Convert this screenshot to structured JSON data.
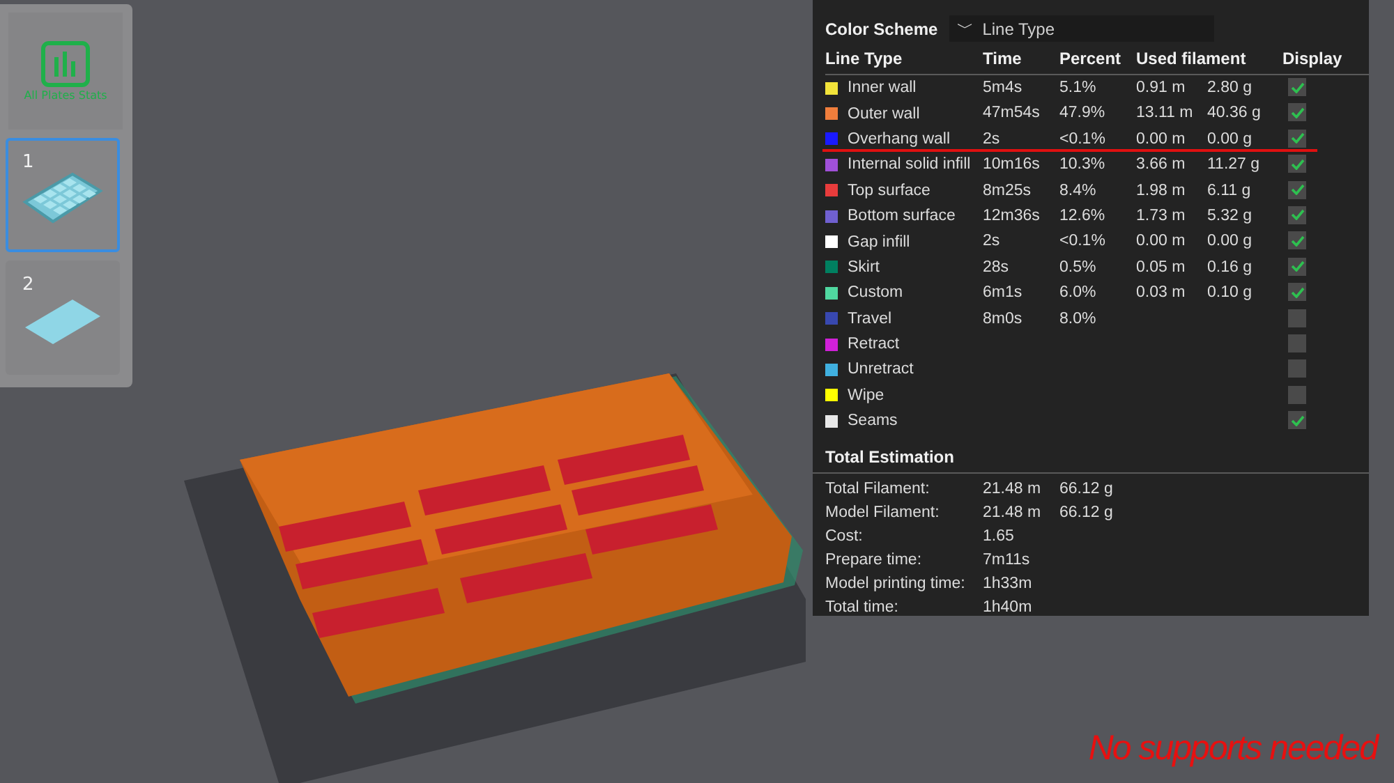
{
  "plates_sidebar": {
    "stats_button": {
      "label": "All Plates Stats"
    },
    "plates": [
      {
        "number": "1",
        "selected": true,
        "kind": "grid"
      },
      {
        "number": "2",
        "selected": false,
        "kind": "flat"
      }
    ]
  },
  "slicing_result": {
    "color_scheme": {
      "label": "Color Scheme",
      "value": "Line Type",
      "caret": "﹀"
    },
    "columns": [
      "Line Type",
      "Time",
      "Percent",
      "Used filament",
      "Display"
    ],
    "rows": [
      {
        "name": "Inner wall",
        "color": "#f2e33a",
        "time": "5m4s",
        "percent": "5.1%",
        "length": "0.91 m",
        "weight": "2.80 g",
        "checked": true,
        "underlined": false
      },
      {
        "name": "Outer wall",
        "color": "#f07e3c",
        "time": "47m54s",
        "percent": "47.9%",
        "length": "13.11 m",
        "weight": "40.36 g",
        "checked": true,
        "underlined": false
      },
      {
        "name": "Overhang wall",
        "color": "#1a1aff",
        "time": "2s",
        "percent": "<0.1%",
        "length": "0.00 m",
        "weight": "0.00 g",
        "checked": true,
        "underlined": true
      },
      {
        "name": "Internal solid infill",
        "color": "#a050d8",
        "time": "10m16s",
        "percent": "10.3%",
        "length": "3.66 m",
        "weight": "11.27 g",
        "checked": true,
        "underlined": false
      },
      {
        "name": "Top surface",
        "color": "#e83c3c",
        "time": "8m25s",
        "percent": "8.4%",
        "length": "1.98 m",
        "weight": "6.11 g",
        "checked": true,
        "underlined": false
      },
      {
        "name": "Bottom surface",
        "color": "#7060d0",
        "time": "12m36s",
        "percent": "12.6%",
        "length": "1.73 m",
        "weight": "5.32 g",
        "checked": true,
        "underlined": false
      },
      {
        "name": "Gap infill",
        "color": "#ffffff",
        "time": "2s",
        "percent": "<0.1%",
        "length": "0.00 m",
        "weight": "0.00 g",
        "checked": true,
        "underlined": false
      },
      {
        "name": "Skirt",
        "color": "#008060",
        "time": "28s",
        "percent": "0.5%",
        "length": "0.05 m",
        "weight": "0.16 g",
        "checked": true,
        "underlined": false
      },
      {
        "name": "Custom",
        "color": "#50d8a0",
        "time": "6m1s",
        "percent": "6.0%",
        "length": "0.03 m",
        "weight": "0.10 g",
        "checked": true,
        "underlined": false
      },
      {
        "name": "Travel",
        "color": "#3848b0",
        "time": "8m0s",
        "percent": "8.0%",
        "checked": false,
        "underlined": false
      },
      {
        "name": "Retract",
        "color": "#d020d8",
        "checked": false,
        "underlined": false
      },
      {
        "name": "Unretract",
        "color": "#40b0e0",
        "checked": false,
        "underlined": false
      },
      {
        "name": "Wipe",
        "color": "#ffff00",
        "checked": false,
        "underlined": false
      },
      {
        "name": "Seams",
        "color": "#e8e8e8",
        "checked": true,
        "underlined": false
      }
    ],
    "total_estimation": {
      "title": "Total Estimation",
      "rows": [
        {
          "label": "Total Filament:",
          "value": "21.48 m",
          "extra": "66.12 g"
        },
        {
          "label": "Model Filament:",
          "value": "21.48 m",
          "extra": "66.12 g"
        },
        {
          "label": "Cost:",
          "value": "1.65"
        },
        {
          "label": "Prepare time:",
          "value": "7m11s"
        },
        {
          "label": "Model printing time:",
          "value": "1h33m"
        },
        {
          "label": "Total time:",
          "value": "1h40m"
        }
      ]
    }
  },
  "caption": "No supports needed"
}
